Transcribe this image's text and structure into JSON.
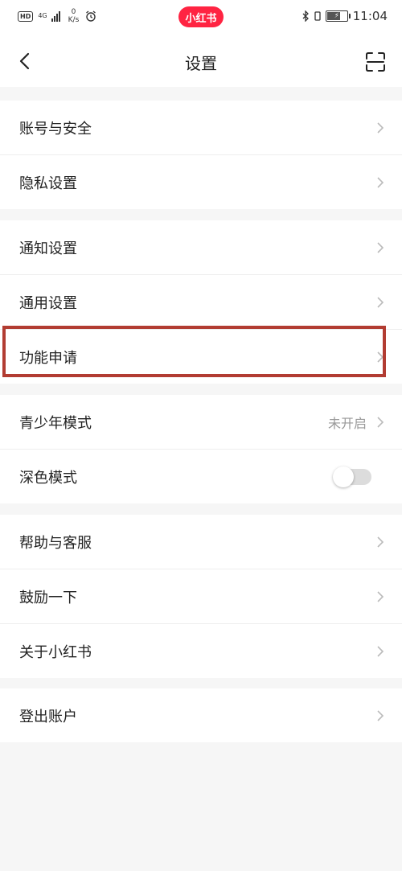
{
  "status_bar": {
    "hd": "HD",
    "network": "4G",
    "speed_value": "0",
    "speed_unit": "K/s",
    "app_name": "小红书",
    "time": "11:04",
    "battery_level_percent": 60
  },
  "nav": {
    "title": "设置"
  },
  "groups": [
    {
      "items": [
        {
          "label": "账号与安全"
        },
        {
          "label": "隐私设置"
        }
      ]
    },
    {
      "items": [
        {
          "label": "通知设置"
        },
        {
          "label": "通用设置"
        },
        {
          "label": "功能申请"
        }
      ]
    },
    {
      "items": [
        {
          "label": "青少年模式",
          "value": "未开启"
        },
        {
          "label": "深色模式",
          "toggle_on": false
        }
      ]
    },
    {
      "items": [
        {
          "label": "帮助与客服"
        },
        {
          "label": "鼓励一下"
        },
        {
          "label": "关于小红书"
        }
      ]
    },
    {
      "items": [
        {
          "label": "登出账户"
        }
      ]
    }
  ],
  "colors": {
    "brand_red": "#ff2442",
    "highlight_border": "#b23c32",
    "background": "#f6f6f6"
  }
}
